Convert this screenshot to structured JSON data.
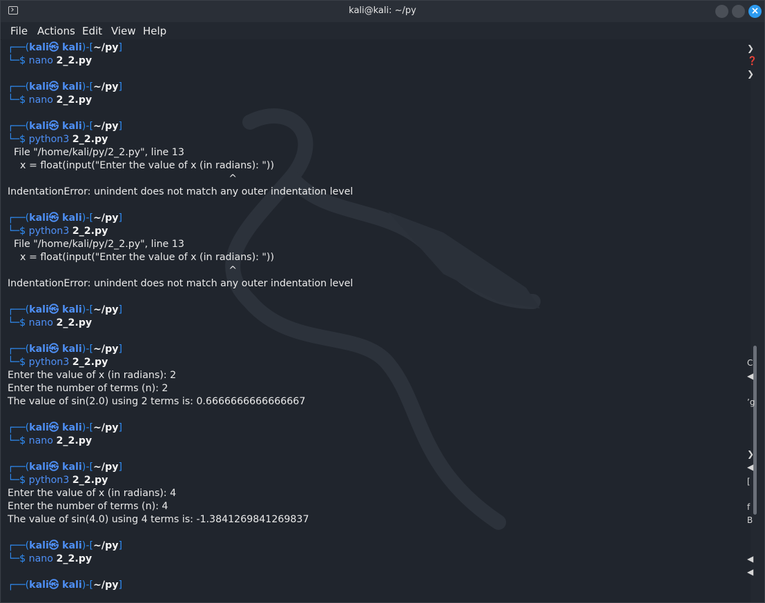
{
  "window": {
    "title": "kali@kali: ~/py",
    "close_glyph": "×"
  },
  "menu": [
    "File",
    "Actions",
    "Edit",
    "View",
    "Help"
  ],
  "lines": [
    {
      "t": "prompt",
      "text": "┌──(kali㉿ kali)-[~/py]"
    },
    {
      "t": "cmd",
      "text": "└─$ nano 2_2.py"
    },
    {
      "t": "blank",
      "text": ""
    },
    {
      "t": "prompt",
      "text": "┌──(kali㉿ kali)-[~/py]"
    },
    {
      "t": "cmd",
      "text": "└─$ nano 2_2.py"
    },
    {
      "t": "blank",
      "text": ""
    },
    {
      "t": "prompt",
      "text": "┌──(kali㉿ kali)-[~/py]"
    },
    {
      "t": "cmd",
      "text": "└─$ python3 2_2.py"
    },
    {
      "t": "out",
      "text": "  File \"/home/kali/py/2_2.py\", line 13"
    },
    {
      "t": "out",
      "text": "    x = float(input(\"Enter the value of x (in radians): \"))"
    },
    {
      "t": "out",
      "text": "                                                                       ^"
    },
    {
      "t": "out",
      "text": "IndentationError: unindent does not match any outer indentation level"
    },
    {
      "t": "blank",
      "text": ""
    },
    {
      "t": "prompt",
      "text": "┌──(kali㉿ kali)-[~/py]"
    },
    {
      "t": "cmd",
      "text": "└─$ python3 2_2.py"
    },
    {
      "t": "out",
      "text": "  File \"/home/kali/py/2_2.py\", line 13"
    },
    {
      "t": "out",
      "text": "    x = float(input(\"Enter the value of x (in radians): \"))"
    },
    {
      "t": "out",
      "text": "                                                                       ^"
    },
    {
      "t": "out",
      "text": "IndentationError: unindent does not match any outer indentation level"
    },
    {
      "t": "blank",
      "text": ""
    },
    {
      "t": "prompt",
      "text": "┌──(kali㉿ kali)-[~/py]"
    },
    {
      "t": "cmd",
      "text": "└─$ nano 2_2.py"
    },
    {
      "t": "blank",
      "text": ""
    },
    {
      "t": "prompt",
      "text": "┌──(kali㉿ kali)-[~/py]"
    },
    {
      "t": "cmd",
      "text": "└─$ python3 2_2.py"
    },
    {
      "t": "out",
      "text": "Enter the value of x (in radians): 2"
    },
    {
      "t": "out",
      "text": "Enter the number of terms (n): 2"
    },
    {
      "t": "out",
      "text": "The value of sin(2.0) using 2 terms is: 0.6666666666666667"
    },
    {
      "t": "blank",
      "text": ""
    },
    {
      "t": "prompt",
      "text": "┌──(kali㉿ kali)-[~/py]"
    },
    {
      "t": "cmd",
      "text": "└─$ nano 2_2.py"
    },
    {
      "t": "blank",
      "text": ""
    },
    {
      "t": "prompt",
      "text": "┌──(kali㉿ kali)-[~/py]"
    },
    {
      "t": "cmd",
      "text": "└─$ python3 2_2.py"
    },
    {
      "t": "out",
      "text": "Enter the value of x (in radians): 4"
    },
    {
      "t": "out",
      "text": "Enter the number of terms (n): 4"
    },
    {
      "t": "out",
      "text": "The value of sin(4.0) using 4 terms is: -1.3841269841269837"
    },
    {
      "t": "blank",
      "text": ""
    },
    {
      "t": "prompt",
      "text": "┌──(kali㉿ kali)-[~/py]"
    },
    {
      "t": "cmd",
      "text": "└─$ nano 2_2.py"
    },
    {
      "t": "blank",
      "text": ""
    },
    {
      "t": "prompt",
      "text": "┌──(kali㉿ kali)-[~/py]"
    }
  ],
  "edge_glyphs": [
    "❯",
    "❓",
    "❯",
    "C",
    "◀",
    "’g",
    "❯",
    "◀",
    "[",
    "f",
    "B",
    "◀",
    "◀"
  ],
  "colors": {
    "background": "#20252d",
    "accent": "#2d9bf0",
    "prompt_blue": "#4e8ff5",
    "path_green": "#2fb07f"
  }
}
